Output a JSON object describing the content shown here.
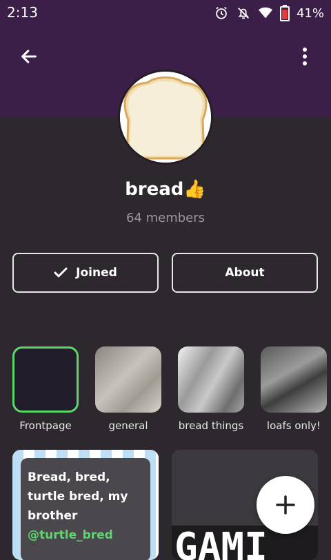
{
  "status": {
    "time": "2:13",
    "battery": "41%"
  },
  "community": {
    "name": "bread👍",
    "members": "64 members"
  },
  "buttons": {
    "joined": "Joined",
    "about": "About"
  },
  "channels": [
    {
      "label": "Frontpage"
    },
    {
      "label": "general"
    },
    {
      "label": "bread things"
    },
    {
      "label": "loafs only!"
    }
  ],
  "posts": [
    {
      "text": "Bread, bred, turtle bred, my brother",
      "mention": "@turtle_bred"
    },
    {
      "text": "GAMI"
    }
  ],
  "colors": {
    "header": "#3b1f48",
    "background": "#2d282e",
    "accent": "#5bd86a"
  },
  "icons": [
    "back-arrow-icon",
    "more-vert-icon",
    "alarm-icon",
    "notifications-off-icon",
    "wifi-icon",
    "battery-icon",
    "check-icon",
    "plus-icon"
  ]
}
